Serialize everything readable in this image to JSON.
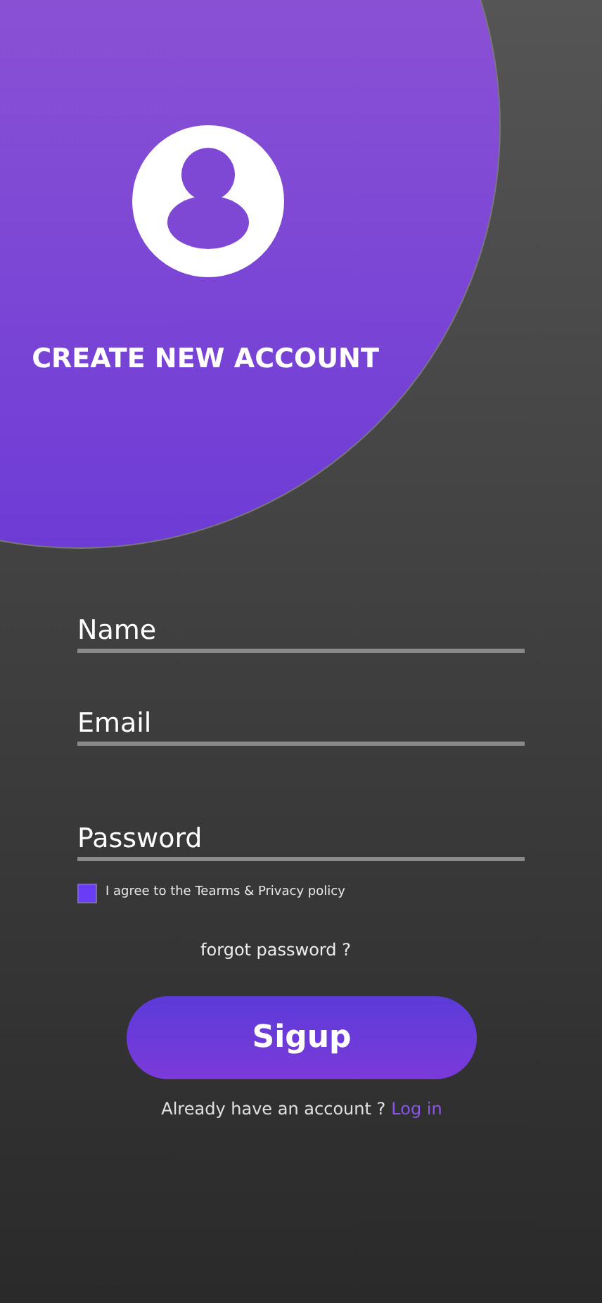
{
  "header": {
    "title": "CREATE NEW ACCOUNT"
  },
  "fields": [
    {
      "placeholder": "Name"
    },
    {
      "placeholder": "Email"
    },
    {
      "placeholder": "Password"
    }
  ],
  "agreement": {
    "label": "I agree to the Tearms & Privacy policy",
    "checked": true
  },
  "forgot_link": "forgot password ?",
  "submit_button": "Sigup",
  "login_prompt": {
    "text": "Already have an account ?",
    "link": "Log in"
  }
}
